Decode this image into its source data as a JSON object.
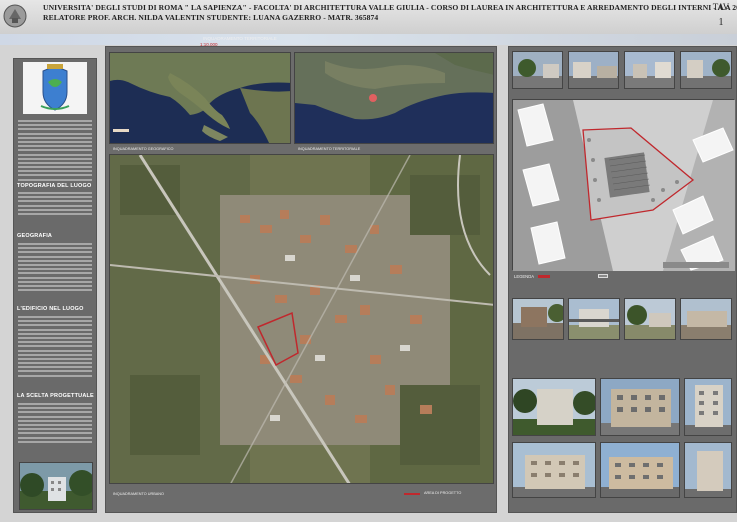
{
  "header": {
    "line1": "UNIVERSITA' DEGLI STUDI DI ROMA \" LA SAPIENZA\"  -  FACOLTA' DI ARCHITETTURA VALLE GIULIA  -  CORSO DI LAUREA IN ARCHITETTURA E ARREDAMENTO DEGLI INTERNI - A.A  2006- 2007",
    "line2": "RELATORE PROF. ARCH. NILDA VALENTIN                    STUDENTE: LUANA GAZERRO  -  MATR. 365874",
    "tav_label": "TAV",
    "tav_number": "1"
  },
  "center": {
    "top_label": "INQUADRAMENTO TERRITORIALE",
    "top_sublabel": "1:10.000",
    "map1_caption": "INQUADRAMENTO GEOGRAFICO",
    "map2_caption": "INQUADRAMENTO TERRITORIALE",
    "aerial_caption": "INQUADRAMENTO URBANO",
    "legend_caption": "AREA DI PROGETTO"
  },
  "sidebar": {
    "sections": [
      {
        "title": "TOPOGRAFIA DEL LUOGO"
      },
      {
        "title": "GEOGRAFIA"
      },
      {
        "title": "L'EDIFICIO NEL LUOGO"
      },
      {
        "title": "LA SCELTA PROGETTUALE"
      }
    ]
  },
  "right": {
    "legend_label": "LEGENDA"
  },
  "colors": {
    "header_bg": "#dadada",
    "panel_gray": "#6a6a6a",
    "site_red": "#c0282d"
  }
}
